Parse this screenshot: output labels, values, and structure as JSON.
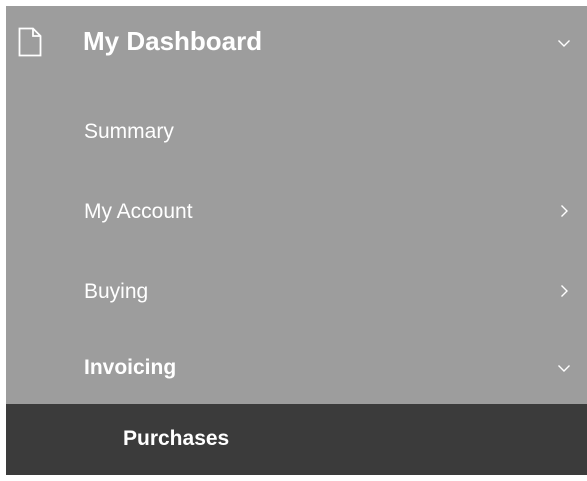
{
  "menu": {
    "header": {
      "label": "My Dashboard",
      "icon": "document-icon",
      "expand_icon": "chevron-down-icon"
    },
    "items": [
      {
        "label": "Summary",
        "bold": false,
        "chevron": "none"
      },
      {
        "label": "My Account",
        "bold": false,
        "chevron": "chevron-right-icon"
      },
      {
        "label": "Buying",
        "bold": false,
        "chevron": "chevron-right-icon"
      },
      {
        "label": "Invoicing",
        "bold": true,
        "chevron": "chevron-down-icon"
      }
    ],
    "submenu": [
      {
        "label": "Purchases"
      }
    ]
  },
  "colors": {
    "menu_background": "#9d9d9d",
    "submenu_background": "#3b3b3b",
    "text": "#ffffff"
  }
}
